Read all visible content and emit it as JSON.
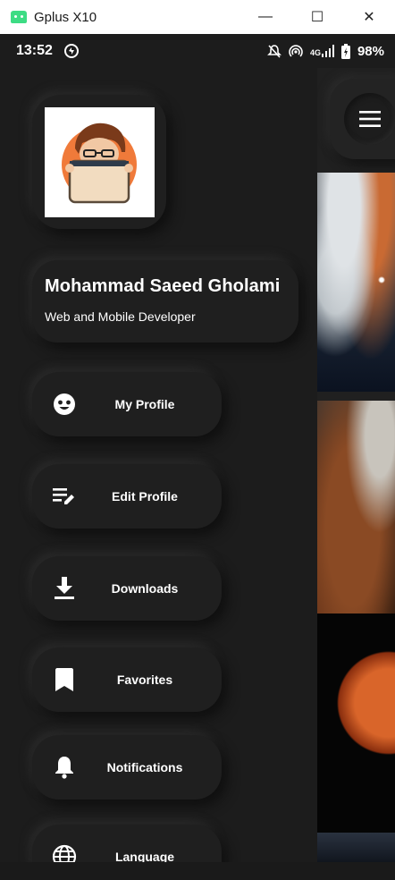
{
  "window": {
    "title": "Gplus X10",
    "minimize_glyph": "—",
    "maximize_glyph": "☐",
    "close_glyph": "✕"
  },
  "status_bar": {
    "time": "13:52",
    "battery_percent": "98%",
    "network_label": "4G"
  },
  "drawer": {
    "user_name": "Mohammad Saeed Gholami",
    "user_role": "Web and Mobile Developer",
    "items": [
      {
        "label": "My Profile",
        "icon": "face-icon"
      },
      {
        "label": "Edit Profile",
        "icon": "edit-list-icon"
      },
      {
        "label": "Downloads",
        "icon": "download-icon"
      },
      {
        "label": "Favorites",
        "icon": "bookmark-icon"
      },
      {
        "label": "Notifications",
        "icon": "bell-icon"
      },
      {
        "label": "Language",
        "icon": "globe-icon"
      }
    ]
  },
  "colors": {
    "background": "#1c1c1c",
    "card": "#1f1f1f",
    "text": "#ffffff"
  }
}
